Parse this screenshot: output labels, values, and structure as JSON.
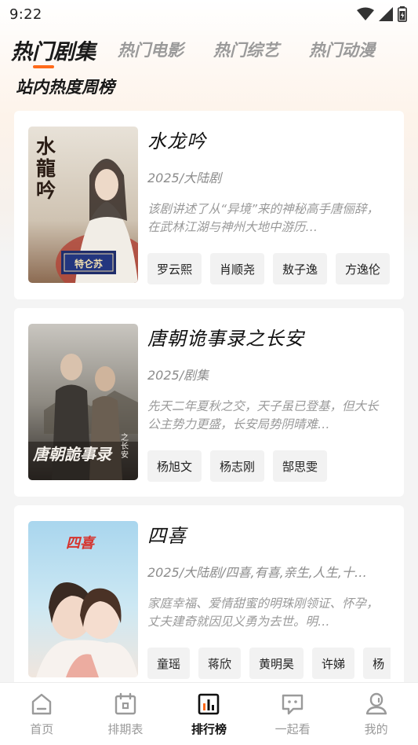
{
  "status_bar": {
    "time": "9:22"
  },
  "tabs": [
    {
      "label": "热门剧集",
      "active": true
    },
    {
      "label": "热门电影",
      "active": false
    },
    {
      "label": "热门综艺",
      "active": false
    },
    {
      "label": "热门动漫",
      "active": false
    }
  ],
  "section_title": "站内热度周榜",
  "shows": [
    {
      "title": "水龙吟",
      "meta": "2025/大陆剧",
      "desc": "该剧讲述了从“异境”来的神秘高手唐俪辞，在武林江湖与神州大地中游历…",
      "cast": [
        "罗云熙",
        "肖顺尧",
        "敖子逸",
        "方逸伦"
      ],
      "poster": {
        "text": "水龍吟",
        "badge": "特仑苏"
      }
    },
    {
      "title": "唐朝诡事录之长安",
      "meta": "2025/剧集",
      "desc": "先天二年夏秋之交，天子虽已登基，但大长公主势力更盛，长安局势阴晴难…",
      "cast": [
        "杨旭文",
        "杨志刚",
        "郜思雯"
      ],
      "poster": {
        "text": "唐朝詭事录",
        "subtext": "之长安"
      }
    },
    {
      "title": "四喜",
      "meta": "2025/大陆剧/四喜,有喜,亲生,人生,十…",
      "desc": "家庭幸福、爱情甜蜜的明珠刚领证、怀孕，丈夫建奇就因见义勇为去世。明…",
      "cast": [
        "童瑶",
        "蒋欣",
        "黄明昊",
        "许娣",
        "杨"
      ],
      "poster": {
        "text": "四喜"
      }
    }
  ],
  "bottom_nav": [
    {
      "label": "首页",
      "icon": "home-icon",
      "active": false
    },
    {
      "label": "排期表",
      "icon": "calendar-icon",
      "active": false
    },
    {
      "label": "排行榜",
      "icon": "ranking-icon",
      "active": true
    },
    {
      "label": "一起看",
      "icon": "chat-icon",
      "active": false
    },
    {
      "label": "我的",
      "icon": "profile-icon",
      "active": false
    }
  ],
  "colors": {
    "accent": "#ff6a1a",
    "text_primary": "#111111",
    "text_secondary": "#8c8c8c",
    "background": "#f4f4f4"
  }
}
